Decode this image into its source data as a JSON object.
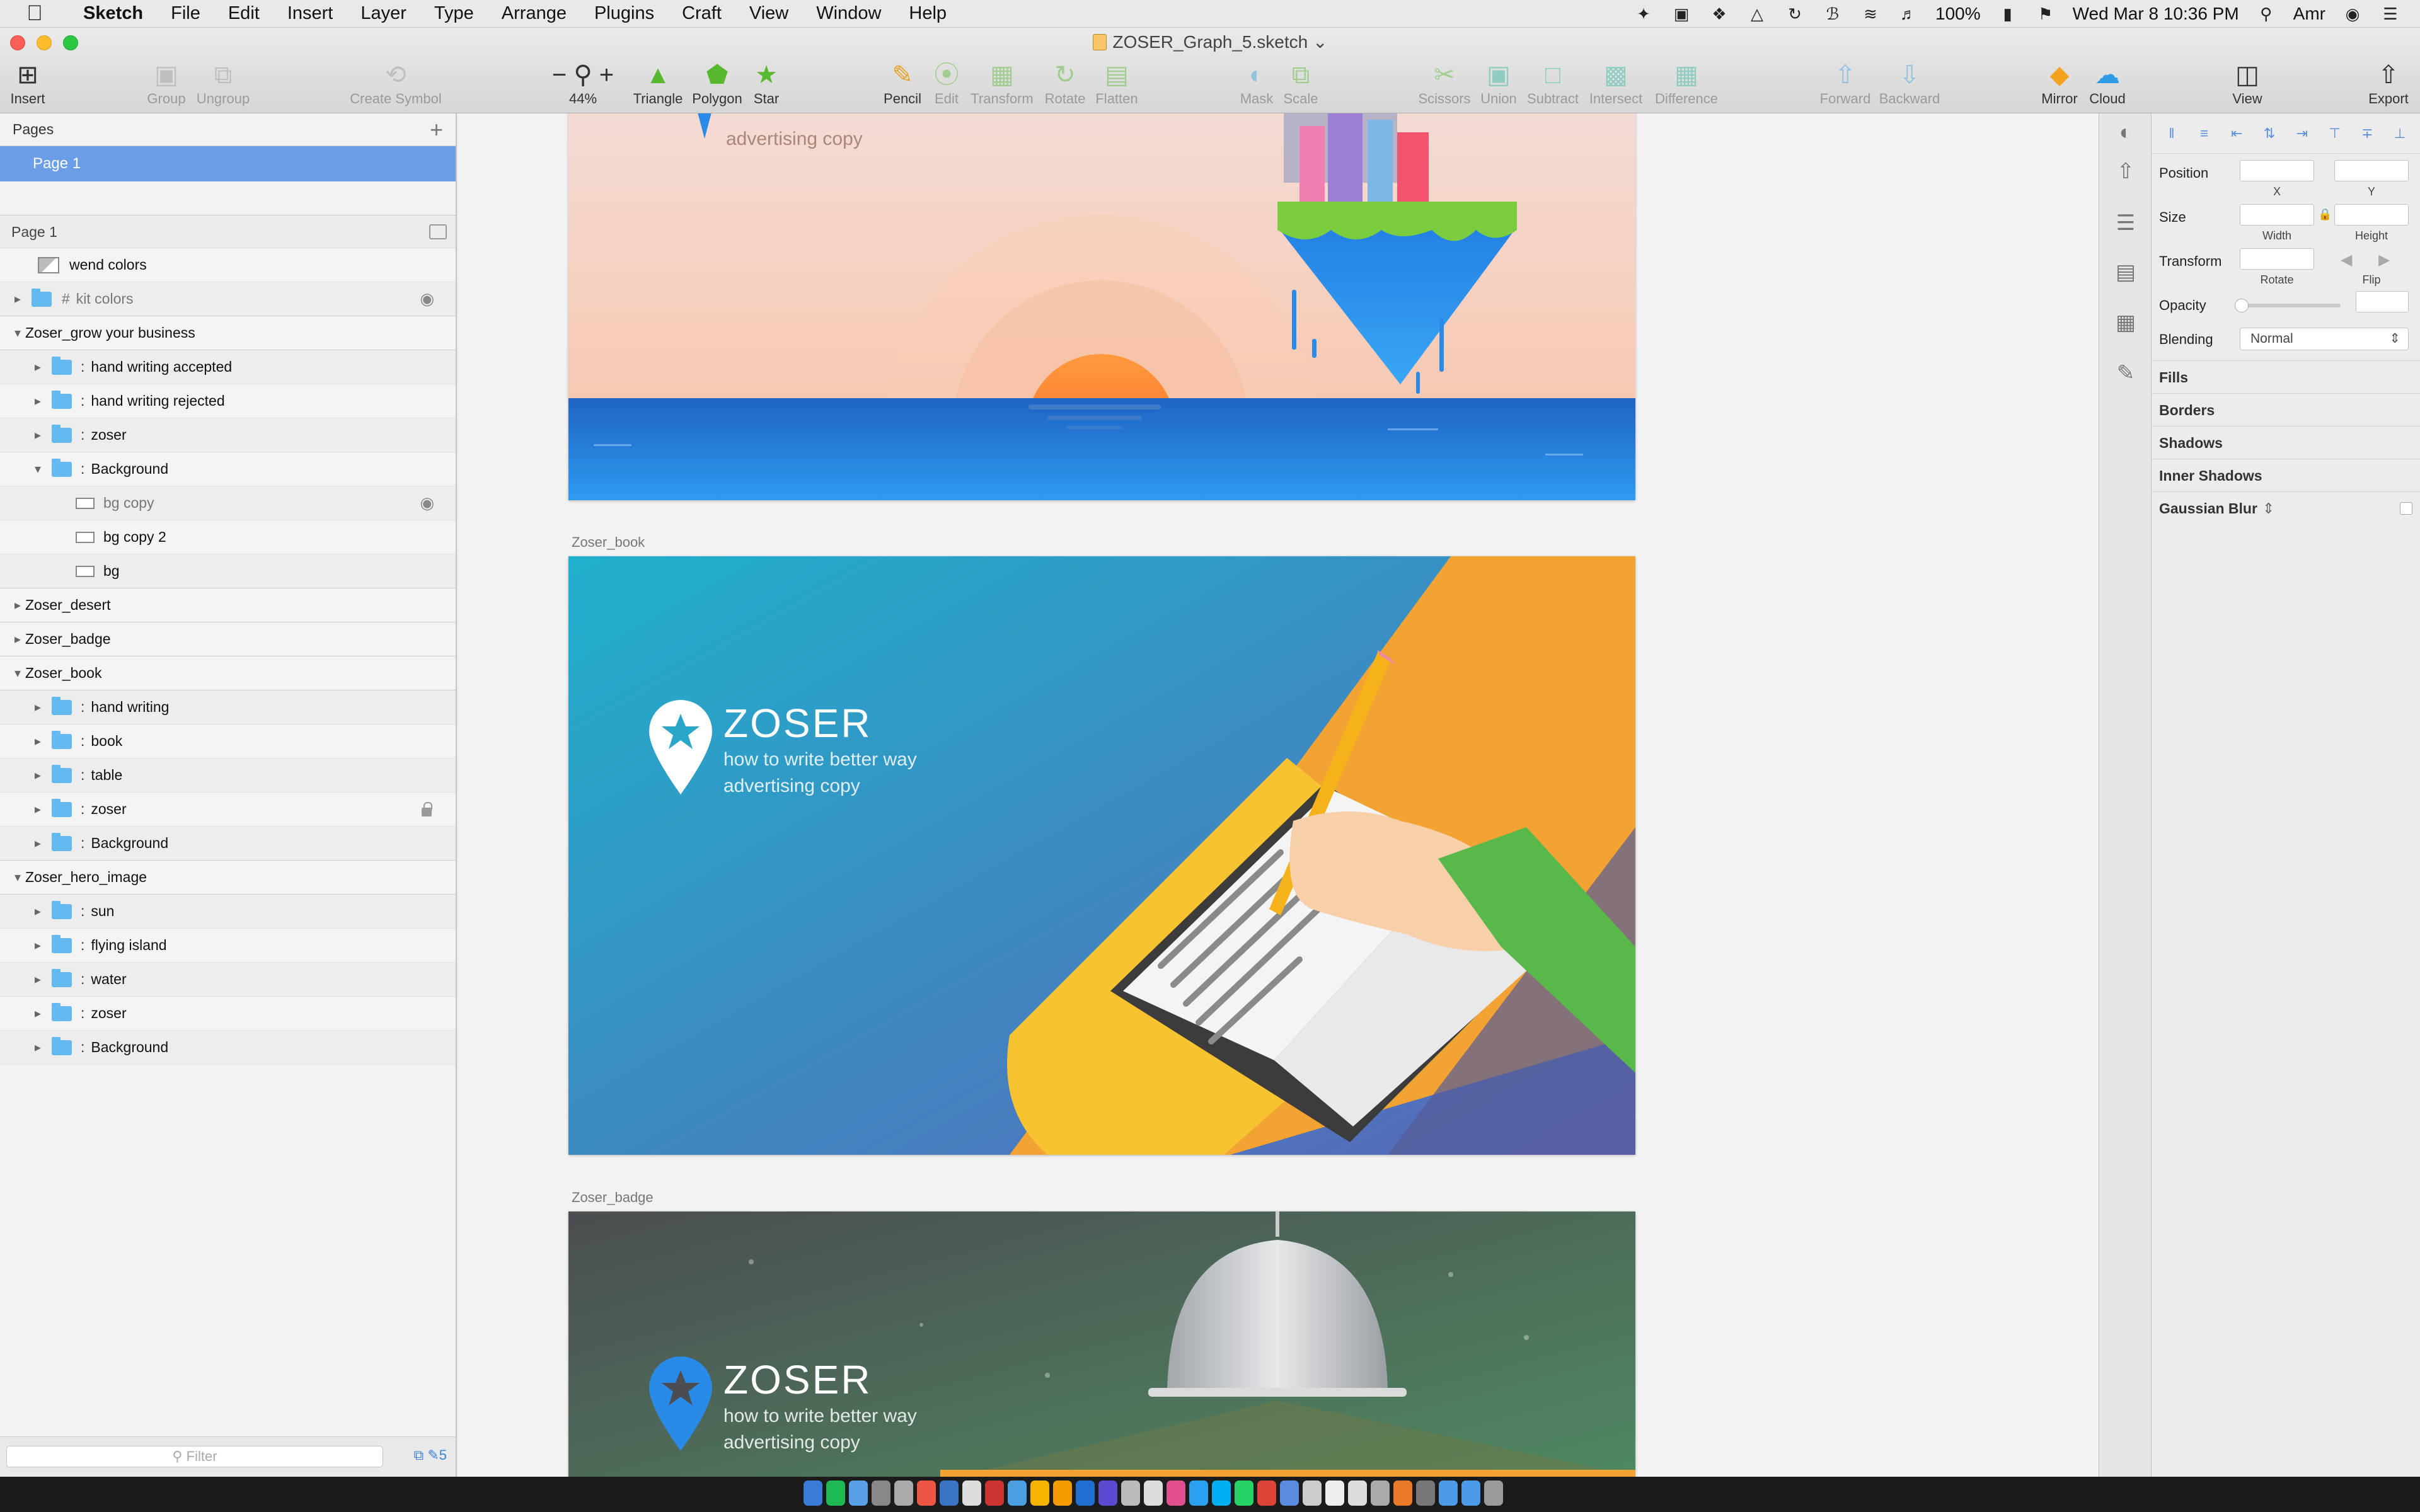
{
  "menubar": {
    "app_name": "Sketch",
    "menus": [
      "File",
      "Edit",
      "Insert",
      "Layer",
      "Type",
      "Arrange",
      "Plugins",
      "Craft",
      "View",
      "Window",
      "Help"
    ],
    "battery": "100%",
    "datetime": "Wed Mar 8  10:36 PM",
    "user": "Amr"
  },
  "window": {
    "title": "ZOSER_Graph_5.sketch"
  },
  "toolbar": {
    "insert": "Insert",
    "group": "Group",
    "ungroup": "Ungroup",
    "create_symbol": "Create Symbol",
    "zoom": "44%",
    "triangle": "Triangle",
    "polygon": "Polygon",
    "star": "Star",
    "pencil": "Pencil",
    "edit": "Edit",
    "transform": "Transform",
    "rotate": "Rotate",
    "flatten": "Flatten",
    "mask": "Mask",
    "scale": "Scale",
    "scissors": "Scissors",
    "union": "Union",
    "subtract": "Subtract",
    "intersect": "Intersect",
    "difference": "Difference",
    "forward": "Forward",
    "backward": "Backward",
    "mirror": "Mirror",
    "cloud": "Cloud",
    "view": "View",
    "export": "Export"
  },
  "sidebar": {
    "pages_title": "Pages",
    "current_page": "Page 1",
    "layers_page": "Page 1",
    "layers": [
      {
        "label": "wend colors"
      },
      {
        "label": "kit colors"
      },
      {
        "label": "Zoser_grow your business"
      },
      {
        "label": "hand writing accepted"
      },
      {
        "label": "hand writing  rejected"
      },
      {
        "label": "zoser"
      },
      {
        "label": "Background"
      },
      {
        "label": "bg copy"
      },
      {
        "label": "bg copy 2"
      },
      {
        "label": "bg"
      },
      {
        "label": "Zoser_desert"
      },
      {
        "label": "Zoser_badge"
      },
      {
        "label": "Zoser_book"
      },
      {
        "label": "hand writing"
      },
      {
        "label": "book"
      },
      {
        "label": "table"
      },
      {
        "label": "zoser"
      },
      {
        "label": "Background"
      },
      {
        "label": "Zoser_hero_image"
      },
      {
        "label": "sun"
      },
      {
        "label": "flying island"
      },
      {
        "label": "water"
      },
      {
        "label": "zoser"
      },
      {
        "label": "Background"
      }
    ],
    "filter_placeholder": "Filter",
    "footer_count": "5"
  },
  "canvas": {
    "hero_tagline": "advertising copy",
    "book_label": "Zoser_book",
    "badge_label": "Zoser_badge",
    "brand_name": "ZOSER",
    "tagline_1": "how to write better way",
    "tagline_2": "advertising copy"
  },
  "inspector": {
    "position": "Position",
    "x": "X",
    "y": "Y",
    "size": "Size",
    "width": "Width",
    "height": "Height",
    "transform": "Transform",
    "rotate": "Rotate",
    "flip": "Flip",
    "opacity": "Opacity",
    "blending": "Blending",
    "blending_value": "Normal",
    "sections": [
      "Fills",
      "Borders",
      "Shadows",
      "Inner Shadows",
      "Gaussian Blur"
    ]
  },
  "colors": {
    "selection": "#6b9ee6",
    "folder": "#63b9f0",
    "hero_sky": "#f7c9b3",
    "sea": "#2f8fe6",
    "book_bg": "#2aa6c9",
    "badge_bg": "#4a4e50"
  }
}
